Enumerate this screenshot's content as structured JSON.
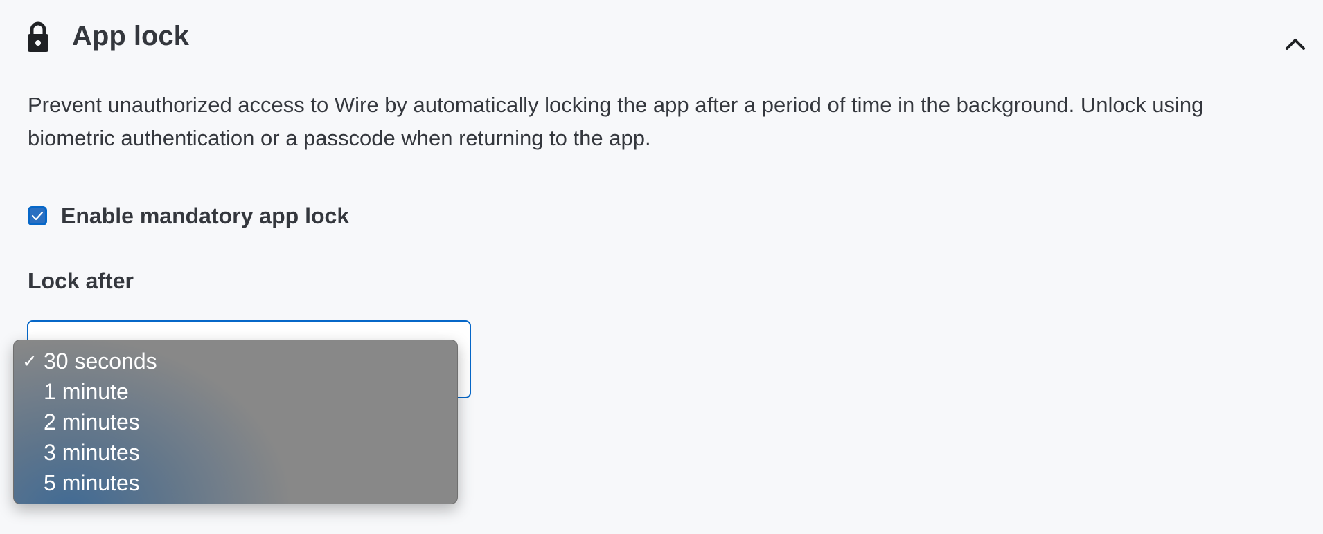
{
  "section": {
    "title": "App lock",
    "icon": "lock-icon",
    "collapse_icon": "chevron-up-icon",
    "description": "Prevent unauthorized access to Wire by automatically locking the app after a period of time in the background. Unlock using biometric authentication or a passcode when returning to the app."
  },
  "mandatory_lock": {
    "label": "Enable mandatory app lock",
    "checked": true,
    "check_icon": "checkmark-icon"
  },
  "lock_after": {
    "label": "Lock after",
    "selected_value": "30 seconds",
    "options": [
      {
        "label": "30 seconds",
        "selected": true
      },
      {
        "label": "1 minute",
        "selected": false
      },
      {
        "label": "2 minutes",
        "selected": false
      },
      {
        "label": "3 minutes",
        "selected": false
      },
      {
        "label": "5 minutes",
        "selected": false
      }
    ],
    "selected_mark": "✓"
  },
  "colors": {
    "accent": "#0667c8",
    "checkbox_fill": "#2a6fc1",
    "text": "#34373d",
    "background": "#f7f8fa",
    "menu_background": "#888888"
  }
}
